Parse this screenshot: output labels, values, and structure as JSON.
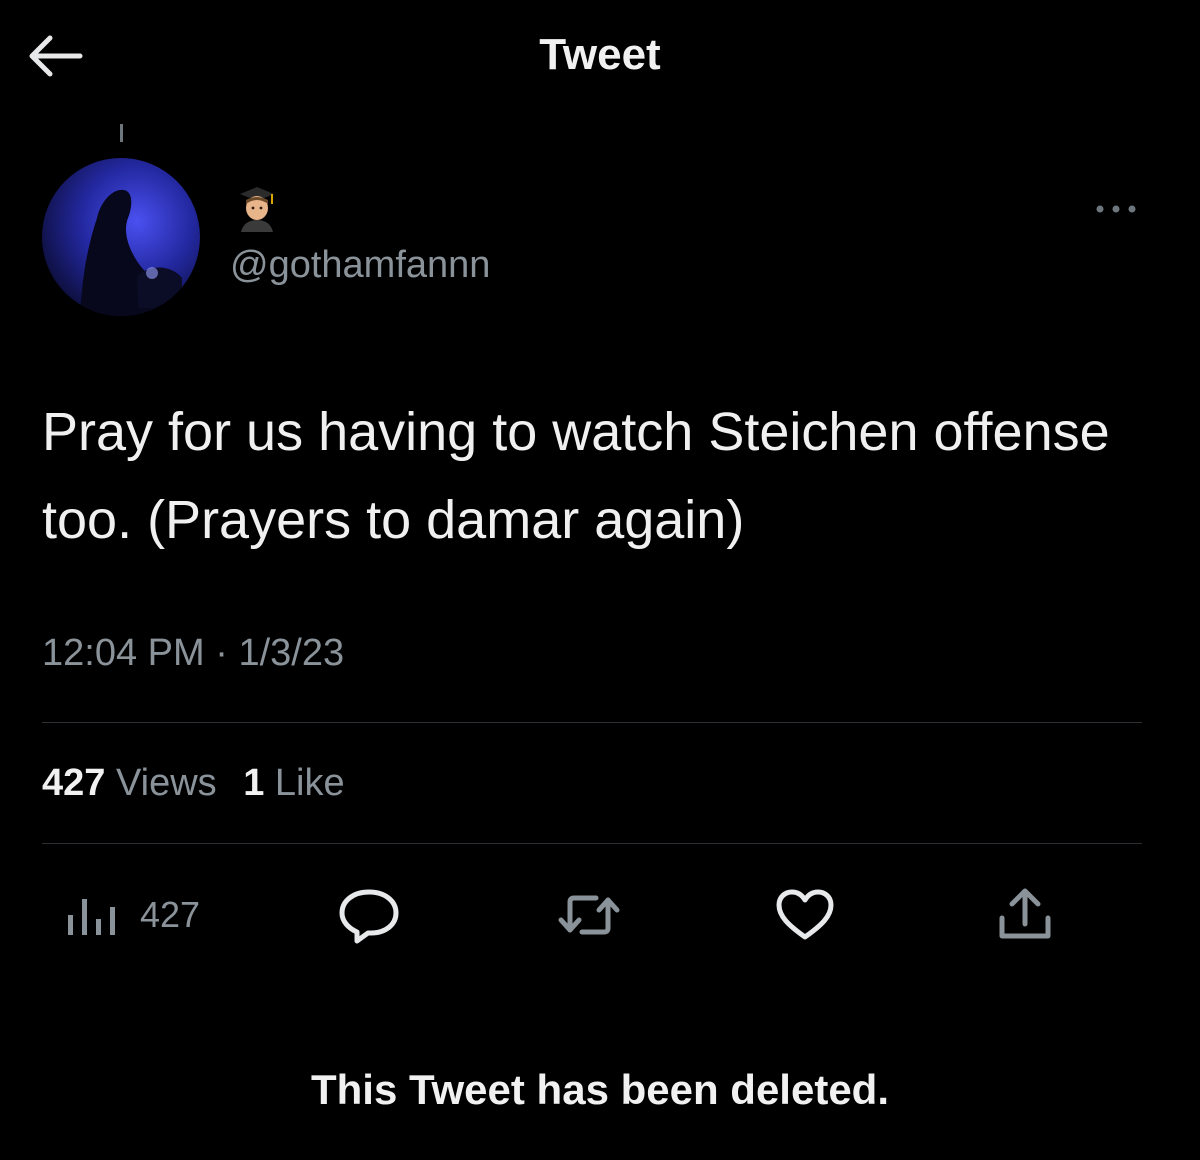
{
  "header": {
    "title": "Tweet",
    "back_icon": "back-arrow-icon"
  },
  "tweet": {
    "handle": "@gothamfannn",
    "name_emoji": "student-emoji",
    "text": "Pray for us having to watch Steichen offense too. (Prayers to damar again)",
    "time": "12:04 PM",
    "date": "1/3/23",
    "timestamp_separator": "·",
    "views_count": "427",
    "views_label": "Views",
    "likes_count": "1",
    "likes_label": "Like"
  },
  "actions": {
    "views_count": "427",
    "icons": [
      "views-chart-icon",
      "reply-icon",
      "retweet-icon",
      "like-heart-icon",
      "share-icon"
    ]
  },
  "notice": {
    "text": "This Tweet has been deleted."
  },
  "colors": {
    "background": "#000000",
    "primary_text": "#e7e9ea",
    "secondary_text": "#8b939a",
    "divider": "#2b2f33",
    "avatar_accent": "#3b3fd6"
  }
}
